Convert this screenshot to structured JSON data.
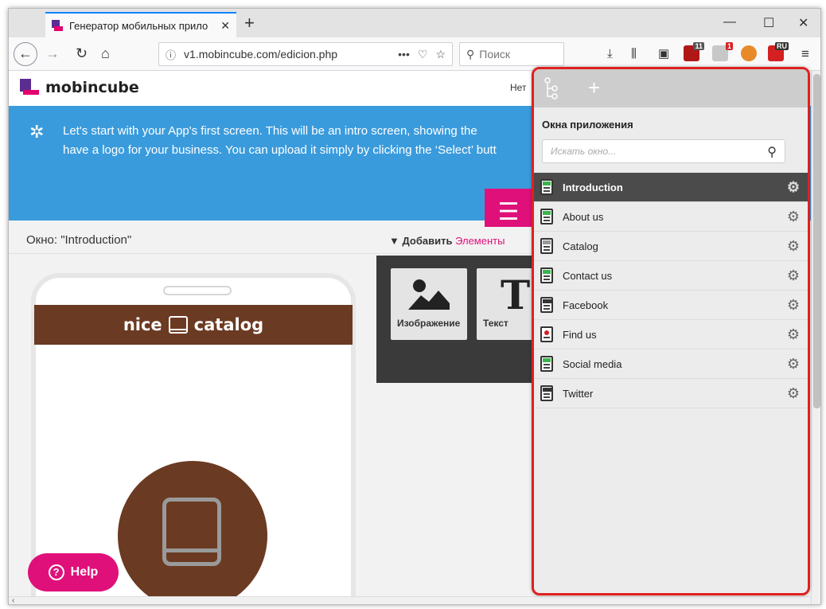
{
  "browser": {
    "tab_title": "Генератор мобильных прило",
    "tab_close": "✕",
    "new_tab": "+",
    "url": "v1.mobincube.com/edicion.php",
    "search_placeholder": "Поиск",
    "ext_badge_1": "11",
    "ext_badge_2": "1",
    "ext_badge_3": "RU"
  },
  "page": {
    "logo_text": "mobincube",
    "header_right": "Нет",
    "banner_line1": "Let's start with your App's first screen. This will be an intro screen, showing the",
    "banner_line2": "have a logo for your business. You can upload it simply by clicking the ‘Select’ butt",
    "screen_label": "Окно: \"Introduction\"",
    "add_label": "▼ Добавить",
    "add_label_pink": "Элементы",
    "app_name_left": "nice",
    "app_name_right": "catalog",
    "tile_image": "Изображение",
    "tile_text": "Текст",
    "help_label": "Help"
  },
  "sidepanel": {
    "title": "Окна приложения",
    "search_placeholder": "Искать окно...",
    "items": [
      {
        "label": "Introduction",
        "icon": "green-doc-icon",
        "active": true
      },
      {
        "label": "About us",
        "icon": "green-doc-icon"
      },
      {
        "label": "Catalog",
        "icon": "list-doc-icon"
      },
      {
        "label": "Contact us",
        "icon": "green-doc-icon"
      },
      {
        "label": "Facebook",
        "icon": "web-doc-icon"
      },
      {
        "label": "Find us",
        "icon": "map-doc-icon"
      },
      {
        "label": "Social media",
        "icon": "green-doc-icon"
      },
      {
        "label": "Twitter",
        "icon": "web-doc-icon"
      }
    ]
  },
  "colors": {
    "accent": "#e0107a",
    "banner": "#3a9bdc",
    "app_brown": "#6b3a22",
    "highlight": "#e02020"
  }
}
